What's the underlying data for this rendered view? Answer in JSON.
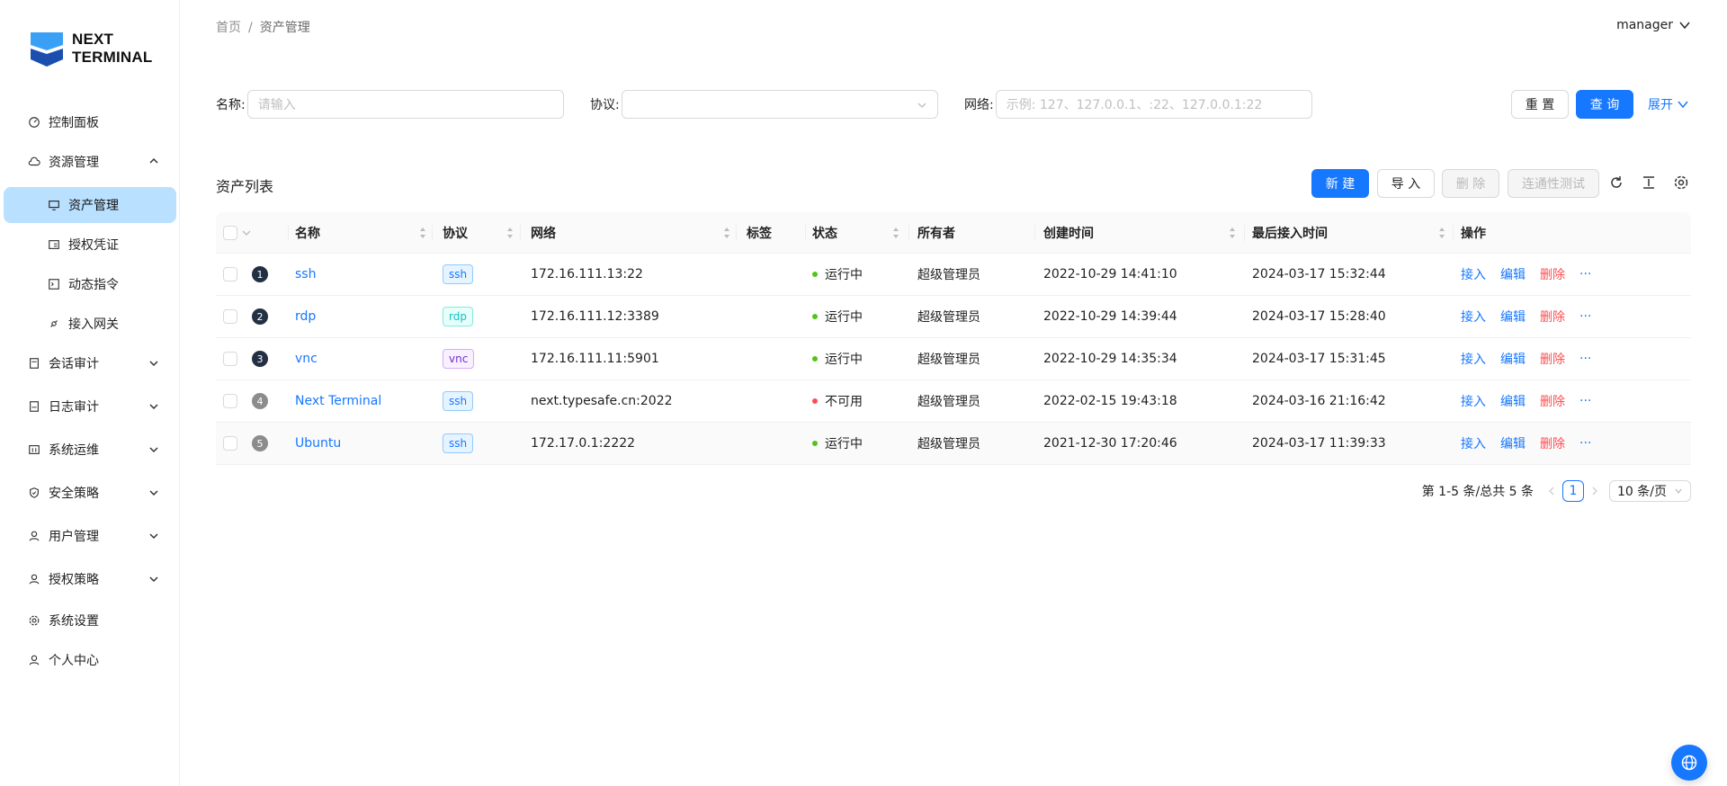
{
  "app": {
    "logo_line1": "NEXT",
    "logo_line2": "TERMINAL"
  },
  "sidebar": {
    "items": [
      {
        "label": "控制面板",
        "icon": "dashboard-icon"
      },
      {
        "label": "资源管理",
        "icon": "cloud-icon",
        "expanded": true
      },
      {
        "label": "资产管理",
        "icon": "desktop-icon",
        "active": true
      },
      {
        "label": "授权凭证",
        "icon": "id-card-icon"
      },
      {
        "label": "动态指令",
        "icon": "code-icon"
      },
      {
        "label": "接入网关",
        "icon": "api-icon"
      },
      {
        "label": "会话审计",
        "icon": "audit-icon"
      },
      {
        "label": "日志审计",
        "icon": "log-icon"
      },
      {
        "label": "系统运维",
        "icon": "tool-icon"
      },
      {
        "label": "安全策略",
        "icon": "safety-icon"
      },
      {
        "label": "用户管理",
        "icon": "user-icon"
      },
      {
        "label": "授权策略",
        "icon": "user-icon"
      },
      {
        "label": "系统设置",
        "icon": "setting-icon"
      },
      {
        "label": "个人中心",
        "icon": "user-icon"
      }
    ]
  },
  "header": {
    "breadcrumb": [
      "首页",
      "资产管理"
    ],
    "breadcrumb_sep": "/",
    "user": "manager"
  },
  "search": {
    "name_label": "名称:",
    "name_placeholder": "请输入",
    "protocol_label": "协议:",
    "protocol_value": "",
    "network_label": "网络:",
    "network_placeholder": "示例: 127、127.0.0.1、:22、127.0.0.1:22",
    "reset": "重 置",
    "query": "查 询",
    "expand": "展开"
  },
  "toolbar": {
    "title": "资产列表",
    "new": "新 建",
    "import": "导 入",
    "delete": "删 除",
    "connectivity": "连通性测试"
  },
  "table": {
    "columns": [
      "名称",
      "协议",
      "网络",
      "标签",
      "状态",
      "所有者",
      "创建时间",
      "最后接入时间",
      "操作"
    ],
    "rows": [
      {
        "idx": "1",
        "name": "ssh",
        "protocol": "ssh",
        "network": "172.16.111.13:22",
        "status": "运行中",
        "status_ok": true,
        "owner": "超级管理员",
        "created": "2022-10-29 14:41:10",
        "last": "2024-03-17 15:32:44"
      },
      {
        "idx": "2",
        "name": "rdp",
        "protocol": "rdp",
        "network": "172.16.111.12:3389",
        "status": "运行中",
        "status_ok": true,
        "owner": "超级管理员",
        "created": "2022-10-29 14:39:44",
        "last": "2024-03-17 15:28:40"
      },
      {
        "idx": "3",
        "name": "vnc",
        "protocol": "vnc",
        "network": "172.16.111.11:5901",
        "status": "运行中",
        "status_ok": true,
        "owner": "超级管理员",
        "created": "2022-10-29 14:35:34",
        "last": "2024-03-17 15:31:45"
      },
      {
        "idx": "4",
        "name": "Next Terminal",
        "protocol": "ssh",
        "network": "next.typesafe.cn:2022",
        "status": "不可用",
        "status_ok": false,
        "owner": "超级管理员",
        "created": "2022-02-15 19:43:18",
        "last": "2024-03-16 21:16:42"
      },
      {
        "idx": "5",
        "name": "Ubuntu",
        "protocol": "ssh",
        "network": "172.17.0.1:2222",
        "status": "运行中",
        "status_ok": true,
        "owner": "超级管理员",
        "created": "2021-12-30 17:20:46",
        "last": "2024-03-17 11:39:33"
      }
    ],
    "actions": [
      "接入",
      "编辑",
      "删除",
      "···"
    ]
  },
  "pagination": {
    "summary": "第 1-5 条/总共 5 条",
    "current": "1",
    "page_size": "10 条/页"
  },
  "colors": {
    "primary": "#1677ff",
    "danger": "#ff4d4f",
    "success": "#52c41a",
    "error": "#ff4d4f",
    "ssh_tag": "#1677ff",
    "rdp_tag": "#13c2c2",
    "vnc_tag": "#722ed1",
    "active_menu_bg": "#bae0ff"
  }
}
